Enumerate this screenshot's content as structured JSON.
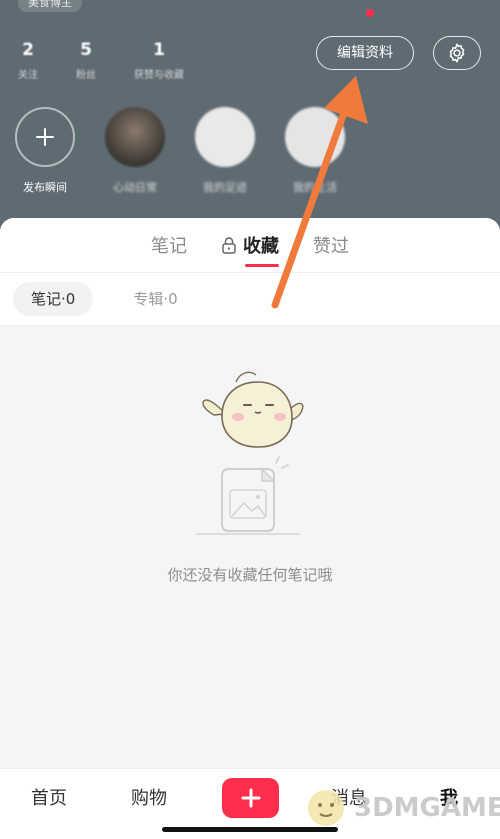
{
  "header": {
    "top_tag": "美食博主",
    "stats": [
      {
        "num": "2",
        "label": "关注"
      },
      {
        "num": "5",
        "label": "粉丝"
      },
      {
        "num": "1",
        "label": "获赞与收藏"
      }
    ],
    "edit_label": "编辑资料",
    "settings_icon": "gear-icon",
    "moments": [
      {
        "label": "发布瞬间",
        "icon": "plus-icon"
      },
      {
        "label": "心动日常"
      },
      {
        "label": "我的足迹"
      },
      {
        "label": "我的生活"
      }
    ]
  },
  "tabs": [
    {
      "label": "笔记",
      "active": false
    },
    {
      "label": "收藏",
      "active": true,
      "icon": "lock-icon"
    },
    {
      "label": "赞过",
      "active": false
    }
  ],
  "subtabs": [
    {
      "label": "笔记·0",
      "active": true
    },
    {
      "label": "专辑·0",
      "active": false
    }
  ],
  "empty": {
    "text": "你还没有收藏任何笔记哦"
  },
  "bottom_nav": {
    "home": "首页",
    "shop": "购物",
    "post_icon": "plus-icon",
    "messages": "消息",
    "me": "我"
  },
  "watermark": {
    "text": "3DMGAME"
  },
  "colors": {
    "header_bg": "#5f6b73",
    "accent": "#ff2e4d",
    "arrow": "#f07a3b"
  }
}
